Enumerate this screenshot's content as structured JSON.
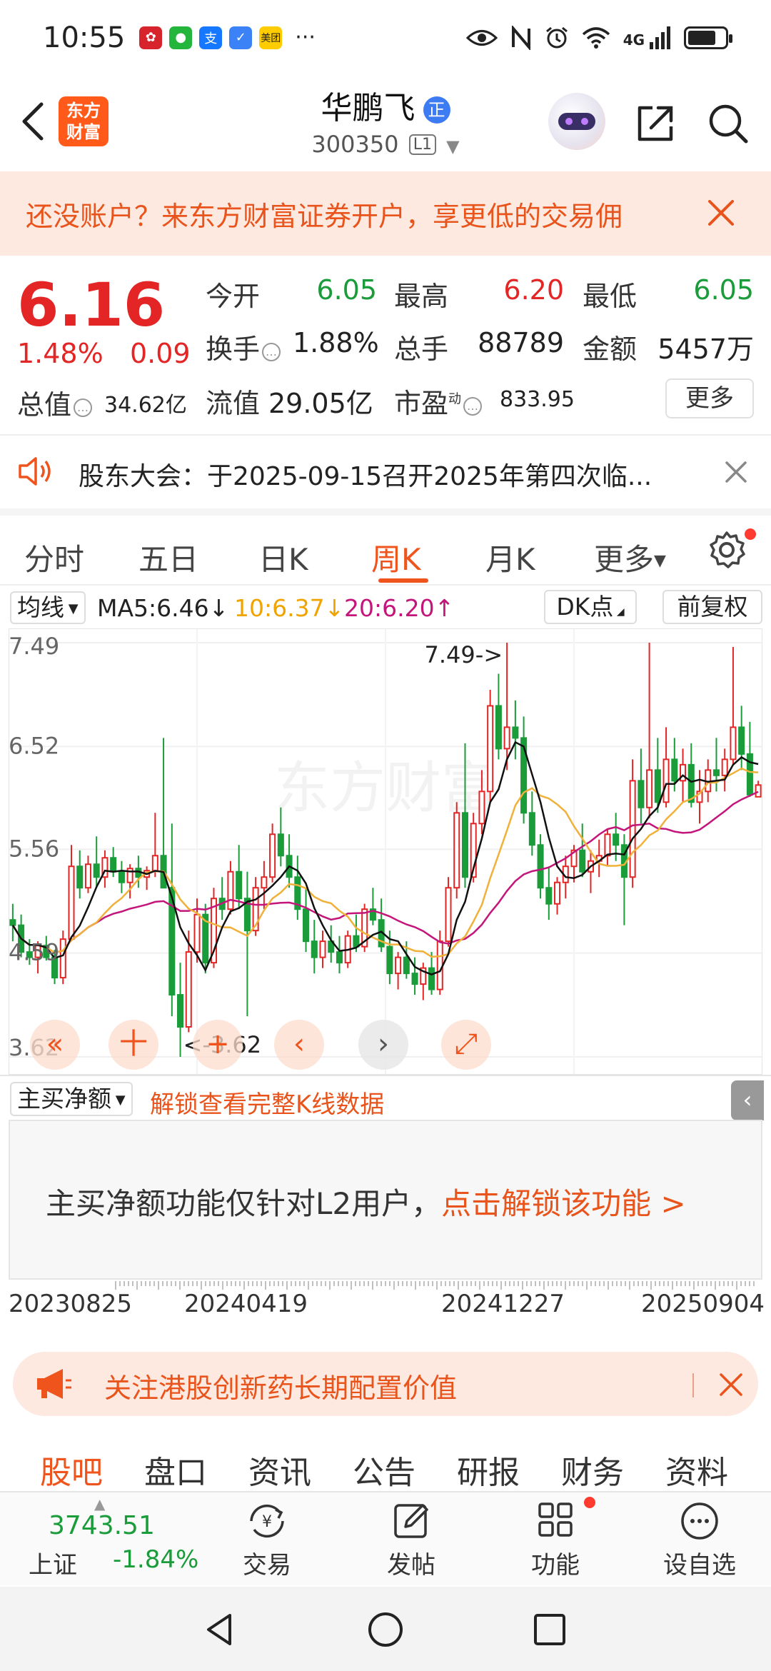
{
  "status_bar": {
    "time": "10:55",
    "notif_app_icons": [
      "huawei-icon",
      "wechat-icon",
      "alipay-icon",
      "shield-icon",
      "meituan-icon"
    ],
    "meituan_text": "美团",
    "alipay_text": "支",
    "more": "···",
    "net_label": "4G",
    "right_icons": [
      "eye-icon",
      "nfc-icon",
      "alarm-icon",
      "wifi-icon",
      "signal-icon",
      "battery-icon"
    ]
  },
  "header": {
    "logo_text_1": "东方",
    "logo_text_2": "财富",
    "stock_name": "华鹏飞",
    "verified_badge": "正",
    "stock_code": "300350",
    "level_tag": "L1"
  },
  "account_banner": {
    "text": "还没账户？来东方财富证券开户，享更低的交易佣"
  },
  "quote": {
    "price": "6.16",
    "change_pct": "1.48%",
    "change": "0.09",
    "open_label": "今开",
    "open": "6.05",
    "high_label": "最高",
    "high": "6.20",
    "low_label": "最低",
    "low": "6.05",
    "turnover_label": "换手",
    "turnover": "1.88%",
    "volume_label": "总手",
    "volume": "88789",
    "amount_label": "金额",
    "amount": "5457万",
    "mktcap_label": "总值",
    "mktcap": "34.62亿",
    "float_label": "流值",
    "float": "29.05亿",
    "pe_label": "市盈",
    "pe_sup": "动",
    "pe": "833.95",
    "more_button": "更多"
  },
  "notice": {
    "text": "股东大会：于2025-09-15召开2025年第四次临..."
  },
  "period_tabs": [
    "分时",
    "五日",
    "日K",
    "周K",
    "月K",
    "更多"
  ],
  "active_period": "周K",
  "ma_bar": {
    "selector": "均线",
    "ma5": "MA5:6.46↓",
    "ma10": "10:6.37↓",
    "ma20": "20:6.20↑",
    "dk_button": "DK点",
    "adjust_button": "前复权"
  },
  "colors": {
    "accent": "#f0541d",
    "up": "#e32525",
    "down": "#1a9c3a",
    "ma5": "#111111",
    "ma10": "#f0b13a",
    "ma20": "#c4157b"
  },
  "chart_data": {
    "type": "candlestick",
    "y_ticks": [
      "7.49",
      "6.52",
      "5.56",
      "4.59",
      "3.62"
    ],
    "ylim": [
      3.62,
      7.49
    ],
    "x_ticks": [
      "20230825",
      "20240419",
      "20241227",
      "20250904"
    ],
    "annotations": {
      "max": "7.49->",
      "min": "<-3.62"
    },
    "watermark": "东方财富",
    "series": [
      {
        "name": "周K",
        "ohlc": [
          [
            4.9,
            5.05,
            4.7,
            4.85
          ],
          [
            4.85,
            4.95,
            4.55,
            4.6
          ],
          [
            4.6,
            4.72,
            4.48,
            4.55
          ],
          [
            4.55,
            4.7,
            4.4,
            4.66
          ],
          [
            4.66,
            4.75,
            4.52,
            4.55
          ],
          [
            4.55,
            4.62,
            4.3,
            4.36
          ],
          [
            4.36,
            4.8,
            4.3,
            4.72
          ],
          [
            4.72,
            5.6,
            4.7,
            5.4
          ],
          [
            5.4,
            5.55,
            5.1,
            5.2
          ],
          [
            5.2,
            5.5,
            5.15,
            5.42
          ],
          [
            5.42,
            5.68,
            5.2,
            5.3
          ],
          [
            5.3,
            5.55,
            5.2,
            5.48
          ],
          [
            5.48,
            5.58,
            5.3,
            5.35
          ],
          [
            5.35,
            5.45,
            5.15,
            5.25
          ],
          [
            5.25,
            5.42,
            5.1,
            5.38
          ],
          [
            5.38,
            5.5,
            5.2,
            5.3
          ],
          [
            5.3,
            5.4,
            5.18,
            5.36
          ],
          [
            5.36,
            5.9,
            5.3,
            5.5
          ],
          [
            5.5,
            6.6,
            5.45,
            5.2
          ],
          [
            5.2,
            5.8,
            4.0,
            4.2
          ],
          [
            4.2,
            4.5,
            3.62,
            3.9
          ],
          [
            3.9,
            4.8,
            3.85,
            4.6
          ],
          [
            4.6,
            5.1,
            4.5,
            4.95
          ],
          [
            4.95,
            5.05,
            4.4,
            4.5
          ],
          [
            4.5,
            5.2,
            4.45,
            5.1
          ],
          [
            5.1,
            5.3,
            4.9,
            5.0
          ],
          [
            5.0,
            5.45,
            4.95,
            5.35
          ],
          [
            5.35,
            5.6,
            5.0,
            5.1
          ],
          [
            5.1,
            5.35,
            4.0,
            4.8
          ],
          [
            4.8,
            5.3,
            4.75,
            5.2
          ],
          [
            5.2,
            5.45,
            5.0,
            5.3
          ],
          [
            5.3,
            5.8,
            5.25,
            5.7
          ],
          [
            5.7,
            5.95,
            5.4,
            5.5
          ],
          [
            5.5,
            5.7,
            5.2,
            5.3
          ],
          [
            5.3,
            5.5,
            4.9,
            5.0
          ],
          [
            5.0,
            5.2,
            4.6,
            4.7
          ],
          [
            4.7,
            4.9,
            4.4,
            4.55
          ],
          [
            4.55,
            4.8,
            4.45,
            4.7
          ],
          [
            4.7,
            4.85,
            4.5,
            4.6
          ],
          [
            4.6,
            4.75,
            4.4,
            4.5
          ],
          [
            4.5,
            4.8,
            4.45,
            4.75
          ],
          [
            4.75,
            4.95,
            4.6,
            4.65
          ],
          [
            4.65,
            5.05,
            4.6,
            5.0
          ],
          [
            5.0,
            5.2,
            4.85,
            4.9
          ],
          [
            4.9,
            5.1,
            4.6,
            4.65
          ],
          [
            4.65,
            4.8,
            4.3,
            4.4
          ],
          [
            4.4,
            4.6,
            4.25,
            4.55
          ],
          [
            4.55,
            4.7,
            4.35,
            4.4
          ],
          [
            4.4,
            4.55,
            4.2,
            4.3
          ],
          [
            4.3,
            4.5,
            4.15,
            4.45
          ],
          [
            4.45,
            4.6,
            4.2,
            4.25
          ],
          [
            4.25,
            4.8,
            4.2,
            4.7
          ],
          [
            4.7,
            5.3,
            4.65,
            5.2
          ],
          [
            5.2,
            6.0,
            5.1,
            5.9
          ],
          [
            5.9,
            6.55,
            5.2,
            5.3
          ],
          [
            5.3,
            5.9,
            5.25,
            5.8
          ],
          [
            5.8,
            6.3,
            5.7,
            6.1
          ],
          [
            6.1,
            7.05,
            6.0,
            6.9
          ],
          [
            6.9,
            7.2,
            6.4,
            6.5
          ],
          [
            6.5,
            7.49,
            6.3,
            6.7
          ],
          [
            6.7,
            6.95,
            6.4,
            6.6
          ],
          [
            6.6,
            6.8,
            5.8,
            5.9
          ],
          [
            5.9,
            6.1,
            5.5,
            5.6
          ],
          [
            5.6,
            5.7,
            5.1,
            5.2
          ],
          [
            5.2,
            5.4,
            4.9,
            5.05
          ],
          [
            5.05,
            5.3,
            4.95,
            5.25
          ],
          [
            5.25,
            5.5,
            5.1,
            5.4
          ],
          [
            5.4,
            5.6,
            5.25,
            5.55
          ],
          [
            5.55,
            5.8,
            5.3,
            5.35
          ],
          [
            5.35,
            5.55,
            5.15,
            5.45
          ],
          [
            5.45,
            5.65,
            5.3,
            5.5
          ],
          [
            5.5,
            5.75,
            5.4,
            5.7
          ],
          [
            5.7,
            5.9,
            5.45,
            5.6
          ],
          [
            5.6,
            5.7,
            4.85,
            5.3
          ],
          [
            5.3,
            6.4,
            5.2,
            6.2
          ],
          [
            6.2,
            6.5,
            5.8,
            5.95
          ],
          [
            5.95,
            7.49,
            5.85,
            6.3
          ],
          [
            6.3,
            6.6,
            5.9,
            6.0
          ],
          [
            6.0,
            6.7,
            5.95,
            6.4
          ],
          [
            6.4,
            6.6,
            6.1,
            6.2
          ],
          [
            6.2,
            6.5,
            6.0,
            6.35
          ],
          [
            6.35,
            6.55,
            5.95,
            6.0
          ],
          [
            6.0,
            6.3,
            5.8,
            6.1
          ],
          [
            6.1,
            6.4,
            6.0,
            6.3
          ],
          [
            6.3,
            6.6,
            6.1,
            6.25
          ],
          [
            6.25,
            6.5,
            6.1,
            6.4
          ],
          [
            6.4,
            7.45,
            6.35,
            6.7
          ],
          [
            6.7,
            6.9,
            6.3,
            6.45
          ],
          [
            6.45,
            6.75,
            6.05,
            6.07
          ],
          [
            6.05,
            6.2,
            6.05,
            6.16
          ]
        ]
      }
    ]
  },
  "chart_controls": [
    "«",
    "十",
    "+",
    "‹",
    "›",
    "⤢"
  ],
  "flow_bar": {
    "selector": "主买净额",
    "unlock_text": "解锁查看完整K线数据"
  },
  "l2_panel": {
    "text": "主买净额功能仅针对L2用户，",
    "link": "点击解锁该功能 >"
  },
  "promo": {
    "text": "关注港股创新药长期配置价值"
  },
  "bottom_tabs": [
    "股吧",
    "盘口",
    "资讯",
    "公告",
    "研报",
    "财务",
    "资料"
  ],
  "active_bottom_tab": "股吧",
  "dock": {
    "index_value": "3743.51",
    "index_name": "上证",
    "index_pct": "-1.84%",
    "trade": "交易",
    "post": "发帖",
    "functions": "功能",
    "watch": "设自选"
  }
}
